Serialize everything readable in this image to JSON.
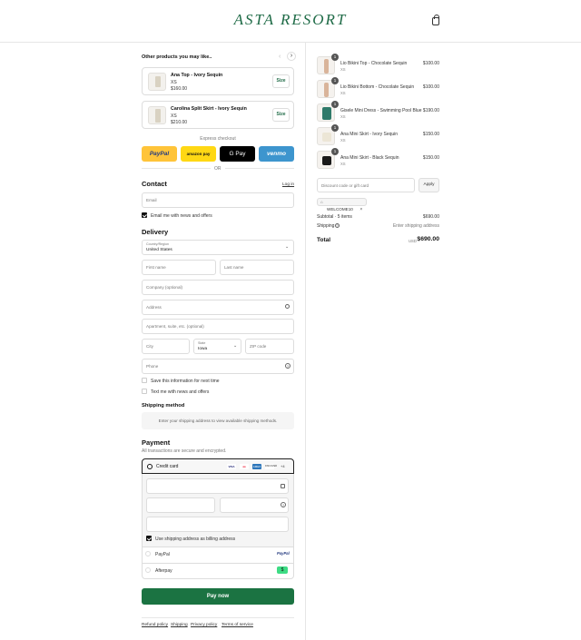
{
  "header": {
    "brand": "ASTA RESORT"
  },
  "upsell": {
    "title": "Other products you may like..",
    "items": [
      {
        "name": "Ana Top - Ivory Sequin",
        "size": "XS",
        "price": "$160.00",
        "button": "Size"
      },
      {
        "name": "Carolina Split Skirt - Ivory Sequin",
        "size": "XS",
        "price": "$210.00",
        "button": "Size"
      }
    ]
  },
  "express": {
    "label": "Express checkout",
    "buttons": {
      "paypal": "PayPal",
      "amazon": "amazon pay",
      "gpay": "G Pay",
      "venmo": "venmo"
    },
    "or": "OR"
  },
  "contact": {
    "title": "Contact",
    "login": "Log in",
    "email_placeholder": "Email",
    "newsletter": "Email me with news and offers"
  },
  "delivery": {
    "title": "Delivery",
    "country_label": "Country/Region",
    "country_value": "United States",
    "first_name": "First name",
    "last_name": "Last name",
    "company": "Company (optional)",
    "address": "Address",
    "apartment": "Apartment, suite, etc. (optional)",
    "city": "City",
    "state_label": "State",
    "state_value": "Iowa",
    "zip": "ZIP code",
    "phone": "Phone",
    "save_info": "Save this information for next time",
    "text_me": "Text me with news and offers"
  },
  "shipping": {
    "title": "Shipping method",
    "message": "Enter your shipping address to view available shipping methods."
  },
  "payment": {
    "title": "Payment",
    "subtitle": "All transactions are secure and encrypted.",
    "credit_card": "Credit card",
    "card_logos": [
      "VISA",
      "MC",
      "AMEX",
      "DISCOVER",
      "+4"
    ],
    "use_shipping": "Use shipping address as billing address",
    "paypal": "PayPal",
    "afterpay": "Afterpay",
    "pay_now": "Pay now"
  },
  "footer": {
    "links": [
      "Refund policy",
      "Shipping",
      "Privacy policy",
      "Terms of service"
    ]
  },
  "summary": {
    "items": [
      {
        "name": "Lio Bikini Top - Chocolate Sequin",
        "variant": "XS",
        "price": "$100.00",
        "qty": "1",
        "color": "#d9b49a"
      },
      {
        "name": "Lio Bikini Bottom - Chocolate Sequin",
        "variant": "XS",
        "price": "$100.00",
        "qty": "1",
        "color": "#d9b49a"
      },
      {
        "name": "Gisele Mini Dress - Swimming Pool Blue",
        "variant": "XS",
        "price": "$190.00",
        "qty": "1",
        "color": "#2f7a6a"
      },
      {
        "name": "Ana Mini Skirt - Ivory Sequin",
        "variant": "XS",
        "price": "$150.00",
        "qty": "1",
        "color": "#ece6d6"
      },
      {
        "name": "Ana Mini Skirt - Black Sequin",
        "variant": "XS",
        "price": "$150.00",
        "qty": "1",
        "color": "#1a1a1a"
      }
    ],
    "discount_placeholder": "Discount code or gift card",
    "apply": "Apply",
    "code": "WELCOME10",
    "subtotal_label": "Subtotal · 5 items",
    "subtotal_value": "$690.00",
    "shipping_label": "Shipping",
    "shipping_value": "Enter shipping address",
    "total_label": "Total",
    "currency": "USD",
    "total_value": "$690.00"
  }
}
